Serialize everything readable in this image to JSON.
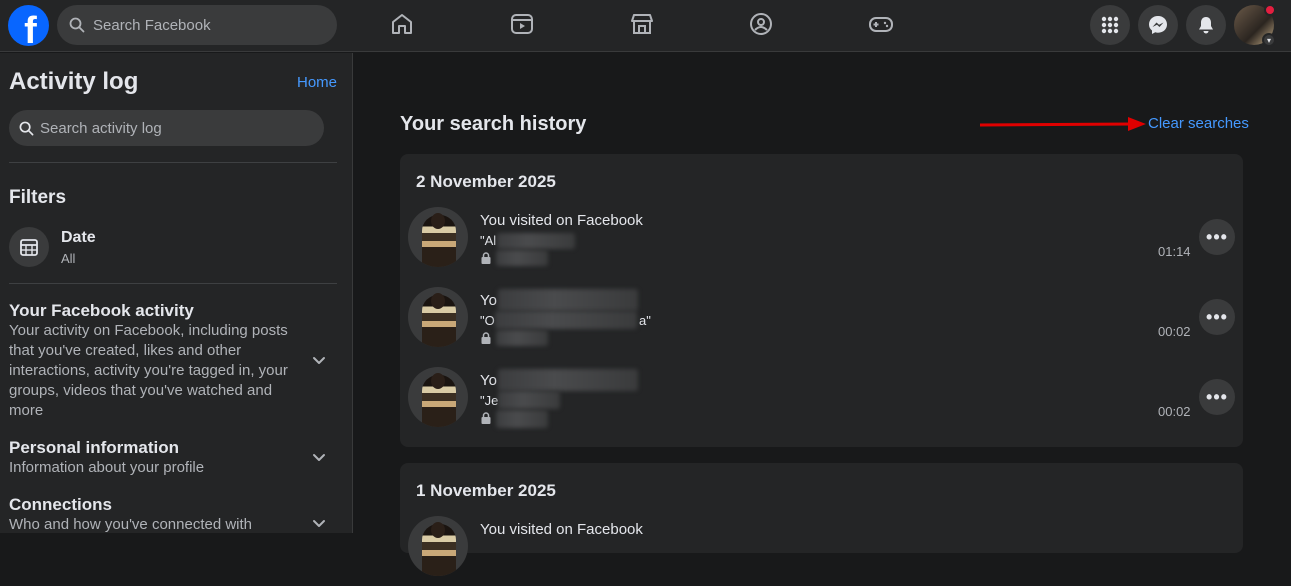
{
  "topbar": {
    "logo": "f",
    "search_placeholder": "Search Facebook",
    "nav_icons": [
      "home-icon",
      "video-icon",
      "marketplace-icon",
      "groups-icon",
      "gaming-icon"
    ],
    "right_icons": [
      "menu-grid-icon",
      "messenger-icon",
      "notifications-icon"
    ]
  },
  "sidebar": {
    "title": "Activity log",
    "home_link": "Home",
    "search_placeholder": "Search activity log",
    "filters_heading": "Filters",
    "date_filter": {
      "label": "Date",
      "value": "All"
    },
    "sections": [
      {
        "heading": "Your Facebook activity",
        "description": "Your activity on Facebook, including posts that you've created, likes and other interactions, activity you're tagged in, your groups, videos that you've watched and more"
      },
      {
        "heading": "Personal information",
        "description": "Information about your profile"
      },
      {
        "heading": "Connections",
        "description": "Who and how you've connected with"
      }
    ]
  },
  "main": {
    "title": "Your search history",
    "clear_link": "Clear searches",
    "groups": [
      {
        "date": "2 November 2025",
        "entries": [
          {
            "line1": "You visited on Facebook",
            "line2": "\"Al",
            "time": "01:14"
          },
          {
            "line1": "Yo",
            "line2": "\"O",
            "line2_tail": "a\"",
            "time": "00:02"
          },
          {
            "line1": "Yo",
            "line2": "\"Je",
            "time": "00:02"
          }
        ]
      },
      {
        "date": "1 November 2025",
        "entries": [
          {
            "line1": "You visited on Facebook"
          }
        ]
      }
    ]
  }
}
